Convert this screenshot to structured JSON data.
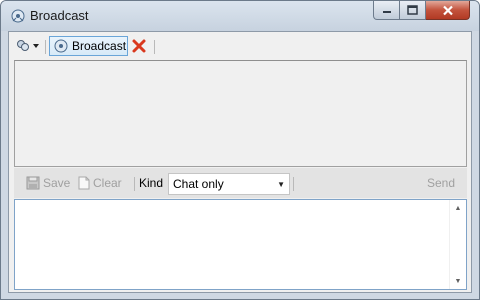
{
  "window": {
    "title": "Broadcast",
    "controls": [
      "minimize",
      "maximize",
      "close"
    ]
  },
  "toolbar_top": {
    "dropdown_icon": "users-gear-icon",
    "tab": {
      "label": "Broadcast",
      "icon": "broadcast-icon"
    },
    "close_icon": "red-x-icon"
  },
  "toolbar_bottom": {
    "save_label": "Save",
    "clear_label": "Clear",
    "kind_label": "Kind",
    "kind_value": "Chat only",
    "send_label": "Send"
  },
  "colors": {
    "accent": "#6aa5d8",
    "close_button": "#c3533d",
    "disabled_text": "#a0a0a0"
  }
}
